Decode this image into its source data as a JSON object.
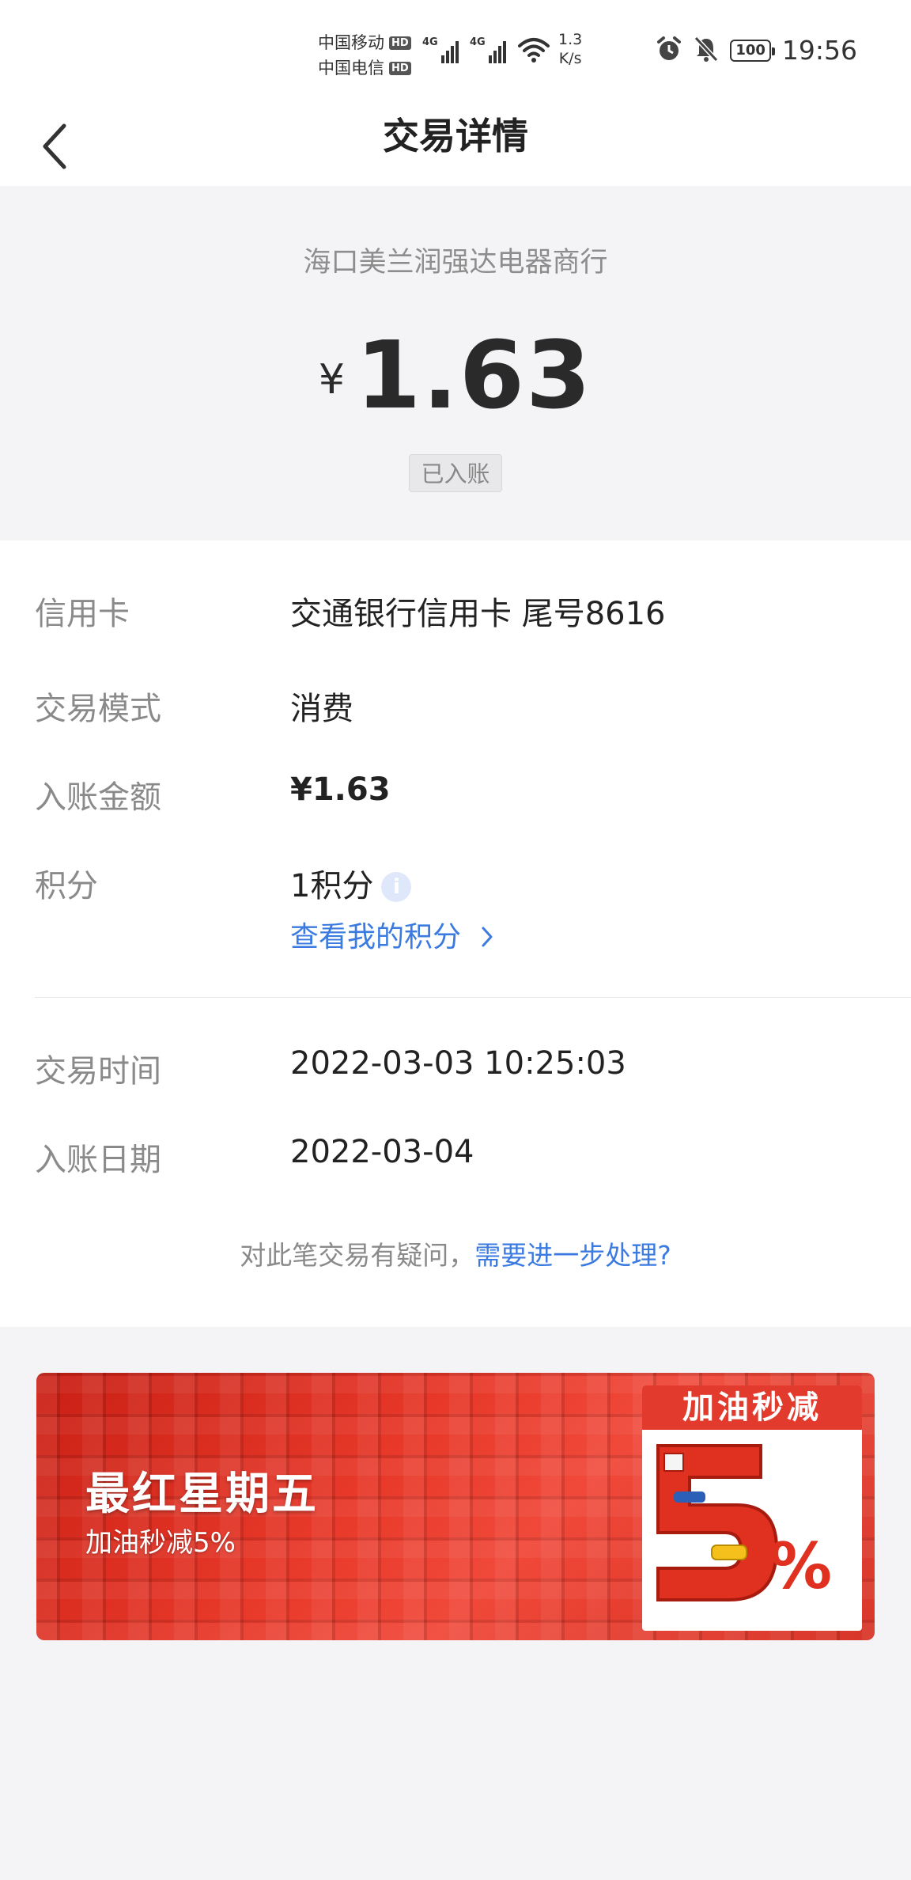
{
  "status_bar": {
    "carrier1": "中国移动",
    "carrier2": "中国电信",
    "hd": "HD",
    "network1": "4G",
    "network2": "4G",
    "speed_value": "1.3",
    "speed_unit": "K/s",
    "battery": "100",
    "time": "19:56"
  },
  "nav": {
    "title": "交易详情",
    "back_icon": "chevron-left-icon"
  },
  "header": {
    "merchant": "海口美兰润强达电器商行",
    "currency": "¥",
    "amount": "1.63",
    "status_badge": "已入账"
  },
  "details": {
    "card_label": "信用卡",
    "card_value": "交通银行信用卡 尾号8616",
    "mode_label": "交易模式",
    "mode_value": "消费",
    "posted_amount_label": "入账金额",
    "posted_amount_value": "¥1.63",
    "points_label": "积分",
    "points_value": "1积分",
    "points_info_icon": "info-icon",
    "points_link": "查看我的积分",
    "txn_time_label": "交易时间",
    "txn_time_value": "2022-03-03 10:25:03",
    "post_date_label": "入账日期",
    "post_date_value": "2022-03-04",
    "query_text": "对此笔交易有疑问，",
    "query_link": "需要进一步处理?"
  },
  "banner": {
    "title": "最红星期五",
    "subtitle": "加油秒减5%",
    "promo_head": "加油秒减",
    "promo_big": "5%"
  },
  "colors": {
    "link": "#3b7be0",
    "banner_red": "#e23a2c"
  }
}
